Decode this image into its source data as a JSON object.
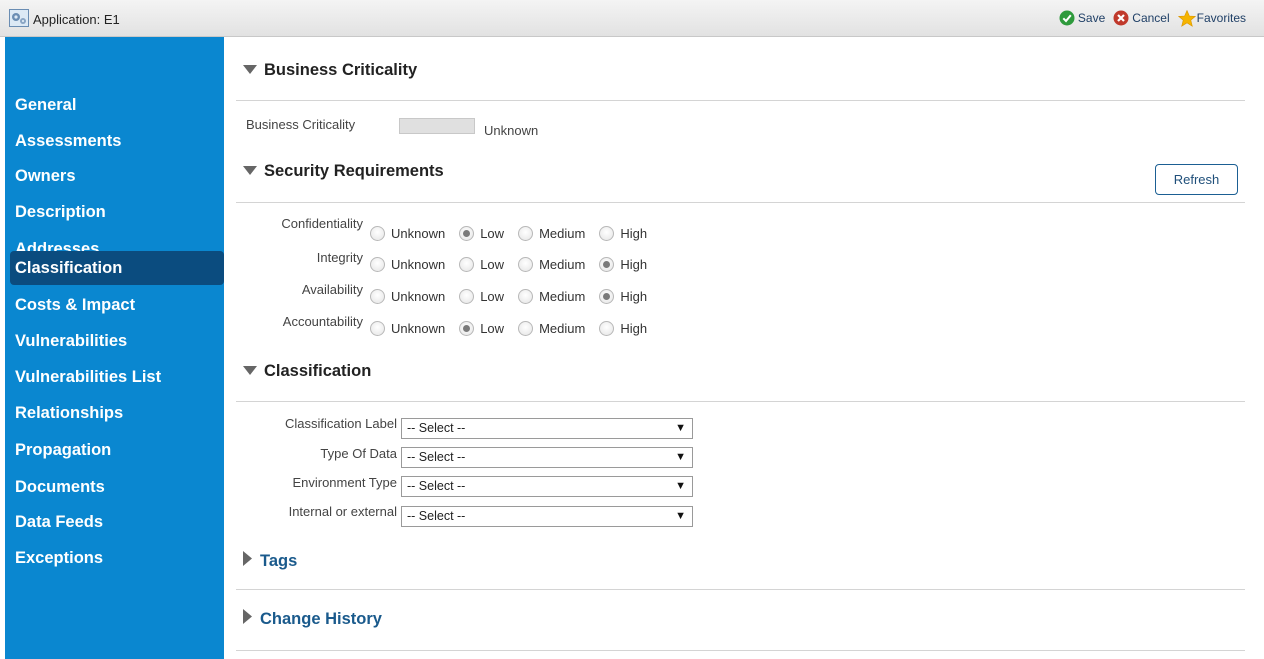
{
  "window": {
    "title": "Application: E1",
    "icon": "gear-app-icon"
  },
  "actions": [
    {
      "label": "Save",
      "icon": "check-icon",
      "color": "#2e9a3c"
    },
    {
      "label": "Cancel",
      "icon": "cancel-icon",
      "color": "#c0392b"
    },
    {
      "label": "Favorites",
      "icon": "star-icon",
      "color": "#f5b400"
    }
  ],
  "sidebar": {
    "active": "Classification",
    "items": [
      {
        "label": "General"
      },
      {
        "label": "Assessments"
      },
      {
        "label": "Owners"
      },
      {
        "label": "Description"
      },
      {
        "label": "Addresses"
      },
      {
        "label": "Classification"
      },
      {
        "label": "Costs & Impact"
      },
      {
        "label": "Vulnerabilities"
      },
      {
        "label": "Vulnerabilities List"
      },
      {
        "label": "Relationships"
      },
      {
        "label": "Propagation"
      },
      {
        "label": "Documents"
      },
      {
        "label": "Data Feeds"
      },
      {
        "label": "Exceptions"
      }
    ]
  },
  "business_criticality": {
    "header": "Business Criticality",
    "field_label": "Business Criticality",
    "value": "Unknown"
  },
  "security_requirements": {
    "header": "Security Requirements",
    "refresh_label": "Refresh",
    "options": [
      "Unknown",
      "Low",
      "Medium",
      "High"
    ],
    "rows": [
      {
        "label": "Confidentiality",
        "selected": "Low"
      },
      {
        "label": "Integrity",
        "selected": "High"
      },
      {
        "label": "Availability",
        "selected": "High"
      },
      {
        "label": "Accountability",
        "selected": "Low"
      }
    ]
  },
  "classification": {
    "header": "Classification",
    "fields": [
      {
        "label": "Classification Label",
        "value": "-- Select --"
      },
      {
        "label": "Type Of Data",
        "value": "-- Select --"
      },
      {
        "label": "Environment Type",
        "value": "-- Select --"
      },
      {
        "label": "Internal or external",
        "value": "-- Select --"
      }
    ]
  },
  "tags": {
    "header": "Tags"
  },
  "change_history": {
    "header": "Change History"
  },
  "colors": {
    "sidebar": "#0a87d0",
    "sidebar_active": "#0b4c7f",
    "link": "#1a5a8c"
  }
}
